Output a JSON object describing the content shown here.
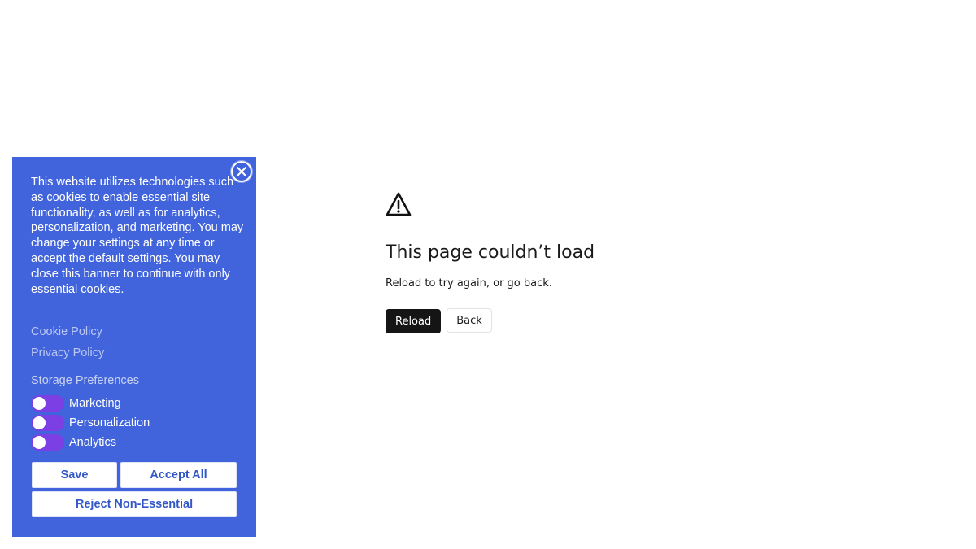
{
  "error_page": {
    "icon": "warning-triangle-icon",
    "title": "This page couldn’t load",
    "message": "Reload to try again, or go back.",
    "reload_label": "Reload",
    "back_label": "Back"
  },
  "cookie_banner": {
    "background_color": "#4164dc",
    "close_icon": "close-circle-icon",
    "body_text": "This website utilizes technologies such as cookies to enable essential site functionality, as well as for analytics, personalization, and marketing. You may change your settings at any time or accept the default settings. You may close this banner to continue with only essential cookies.",
    "links": {
      "cookie_policy": "Cookie Policy",
      "privacy_policy": "Privacy Policy"
    },
    "storage_title": "Storage Preferences",
    "toggles": [
      {
        "label": "Marketing",
        "on": false
      },
      {
        "label": "Personalization",
        "on": false
      },
      {
        "label": "Analytics",
        "on": false
      }
    ],
    "toggle_color": "#7b3fe4",
    "buttons": {
      "save": "Save",
      "accept_all": "Accept All",
      "reject_non_essential": "Reject Non-Essential"
    }
  }
}
